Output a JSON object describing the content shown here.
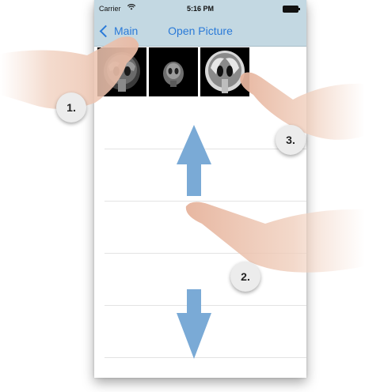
{
  "status": {
    "carrier": "Carrier",
    "time": "5:16 PM"
  },
  "nav": {
    "back_label": "Main",
    "title": "Open Picture"
  },
  "badges": {
    "one": "1.",
    "two": "2.",
    "three": "3."
  },
  "colors": {
    "bar": "#c3d8e2",
    "tint": "#2a7ad8",
    "arrow": "#7aaad6"
  },
  "icons": [
    "wifi-icon",
    "battery-icon",
    "chevron-left-icon",
    "arrow-up-icon",
    "arrow-down-icon"
  ]
}
